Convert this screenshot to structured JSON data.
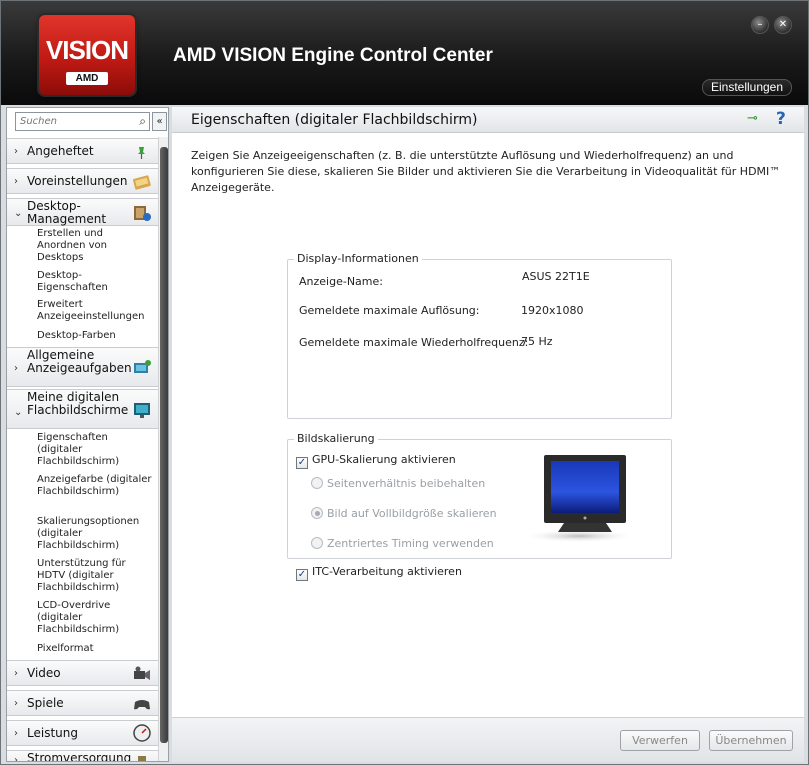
{
  "header": {
    "logo_text": "VISION",
    "logo_badge": "AMD",
    "title": "AMD VISION Engine Control Center",
    "settings_label": "Einstellungen"
  },
  "sidebar": {
    "search_placeholder": "Suchen",
    "categories": [
      {
        "label": "Angeheftet",
        "icon": "pin-icon"
      },
      {
        "label": "Voreinstellungen",
        "icon": "preset-icon"
      },
      {
        "label": "Desktop-Management",
        "icon": "desktop-management-icon"
      },
      {
        "label": "Allgemeine Anzeigeaufgaben",
        "icon": "display-tasks-icon"
      },
      {
        "label": "Meine digitalen Flachbildschirme",
        "icon": "flat-panel-icon"
      },
      {
        "label": "Video",
        "icon": "video-camera-icon"
      },
      {
        "label": "Spiele",
        "icon": "gamepad-icon"
      },
      {
        "label": "Leistung",
        "icon": "gauge-icon"
      },
      {
        "label": "Stromversorgung",
        "icon": "power-icon"
      }
    ],
    "desktop_items": [
      "Erstellen und Anordnen von Desktops",
      "Desktop-Eigenschaften",
      "Erweitert Anzeigeeinstellungen",
      "Desktop-Farben"
    ],
    "flatpanel_items": [
      "Eigenschaften (digitaler Flachbildschirm)",
      "Anzeigefarbe (digitaler Flachbildschirm)",
      "Skalierungsoptionen (digitaler Flachbildschirm)",
      "Unterstützung für HDTV (digitaler Flachbildschirm)",
      "LCD-Overdrive (digitaler Flachbildschirm)",
      "Pixelformat"
    ]
  },
  "main": {
    "title": "Eigenschaften (digitaler Flachbildschirm)",
    "description": "Zeigen Sie Anzeigeeigenschaften (z. B. die unterstützte Auflösung und Wiederholfrequenz) an und konfigurieren Sie diese, skalieren Sie Bilder und aktivieren Sie die Verarbeitung in Videoqualität für HDMI™ Anzeigegeräte.",
    "display_info": {
      "title": "Display-Informationen",
      "rows": [
        {
          "label": "Anzeige-Name:",
          "value": "ASUS 22T1E"
        },
        {
          "label": "Gemeldete maximale Auflösung:",
          "value": "1920x1080"
        },
        {
          "label": "Gemeldete maximale Wiederholfrequenz:",
          "value": "75 Hz"
        }
      ]
    },
    "scaling": {
      "title": "Bildskalierung",
      "gpu_scaling_label": "GPU-Skalierung aktivieren",
      "gpu_scaling_checked": true,
      "options": [
        {
          "label": "Seitenverhältnis beibehalten",
          "selected": false
        },
        {
          "label": "Bild auf Vollbildgröße skalieren",
          "selected": true
        },
        {
          "label": "Zentriertes Timing verwenden",
          "selected": false
        }
      ]
    },
    "itc_label": "ITC-Verarbeitung aktivieren",
    "itc_checked": true,
    "discard_label": "Verwerfen",
    "apply_label": "Übernehmen"
  },
  "colors": {
    "brand_red": "#c01a14",
    "header_dark": "#1a1a1a",
    "help_blue": "#2766b3"
  }
}
